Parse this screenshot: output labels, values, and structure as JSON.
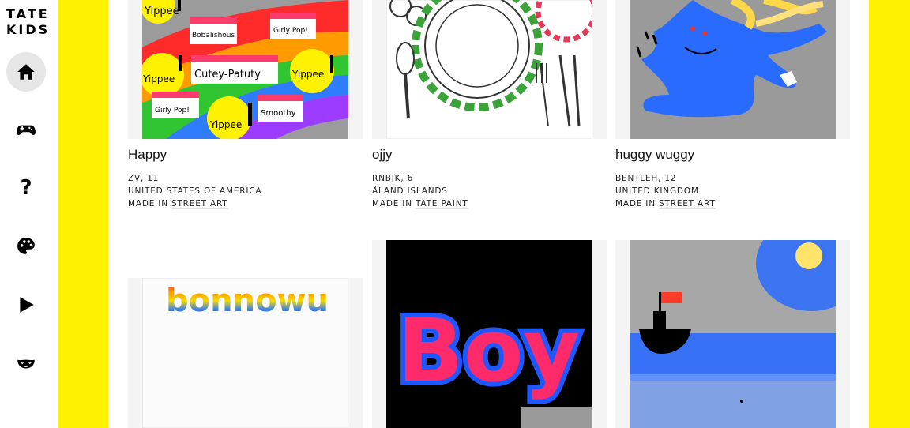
{
  "brand": {
    "logo_line1": "TATE",
    "logo_line2": "KIDS",
    "frame_color": "#fff200"
  },
  "nav": {
    "items": [
      {
        "name": "home",
        "icon": "home-icon",
        "active": true
      },
      {
        "name": "games",
        "icon": "gamepad-icon",
        "active": false
      },
      {
        "name": "quizzes",
        "icon": "question-icon",
        "glyph": "?",
        "active": false
      },
      {
        "name": "make",
        "icon": "palette-icon",
        "active": false
      },
      {
        "name": "watch",
        "icon": "play-icon",
        "active": false
      },
      {
        "name": "explore",
        "icon": "mask-icon",
        "active": false
      }
    ]
  },
  "gallery": {
    "made_in_prefix": "MADE IN",
    "cards": [
      {
        "title": "Happy",
        "author": "ZV, 11",
        "country": "UNITED STATES OF AMERICA",
        "tool": "STREET ART",
        "art_labels": [
          "Yippee",
          "Bobalishous",
          "Girly Pop!",
          "Cutey-Patuty",
          "Yippee",
          "Yippee",
          "Girly Pop!",
          "Smoothy",
          "Yippee"
        ]
      },
      {
        "title": "ojjy",
        "author": "RNBJK, 6",
        "country": "ÅLAND ISLANDS",
        "tool": "TATE PAINT"
      },
      {
        "title": "huggy wuggy",
        "author": "BENTLEH, 12",
        "country": "UNITED KINGDOM",
        "tool": "STREET ART"
      },
      {
        "art_text": "bonnowu"
      },
      {
        "art_text": "Boy"
      },
      {}
    ]
  }
}
